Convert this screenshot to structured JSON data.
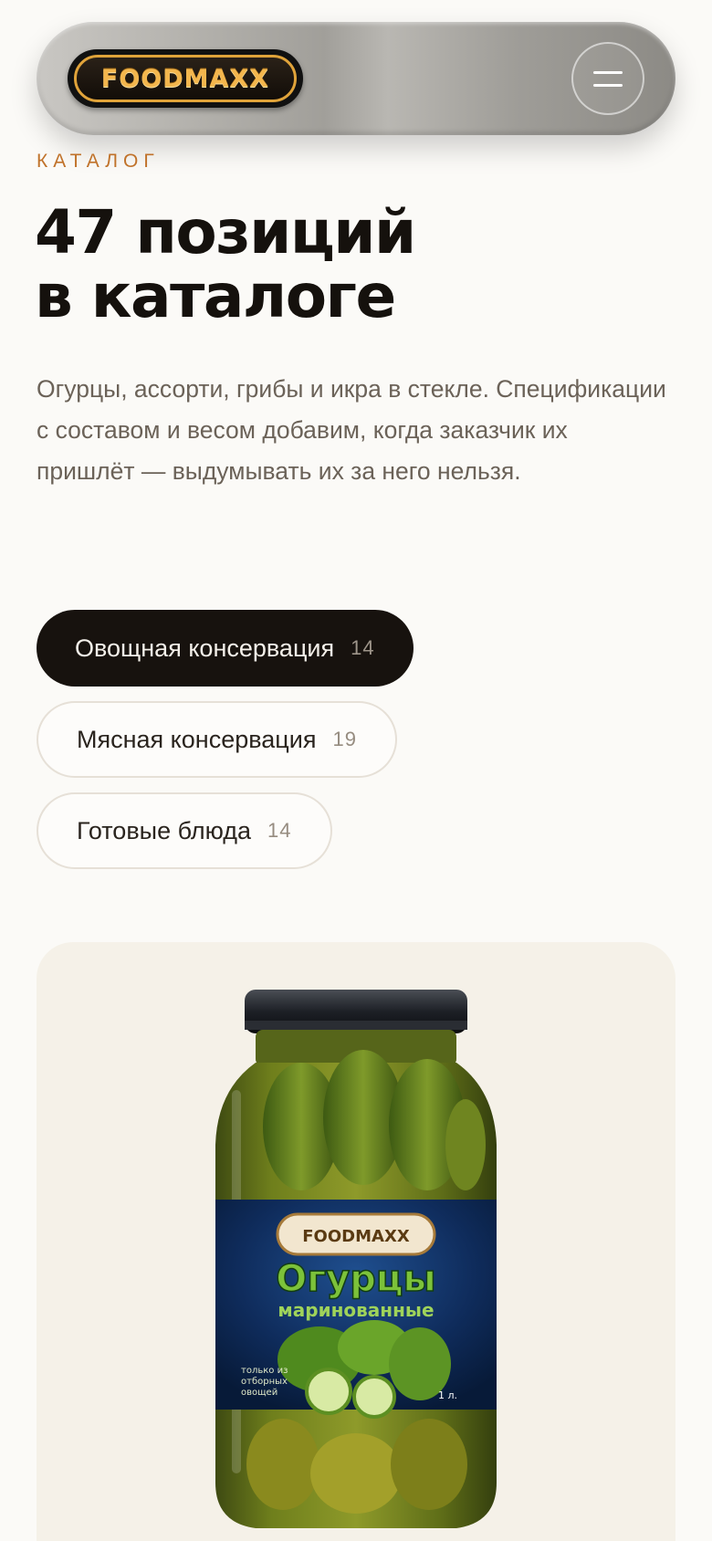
{
  "header": {
    "logo_text": "FOODMAXX",
    "menu_icon": "hamburger-menu-icon"
  },
  "hero": {
    "eyebrow": "КАТАЛОГ",
    "title_line1": "47 позиций",
    "title_line2": "в каталоге",
    "description": "Огурцы, ассорти, грибы и икра в стекле. Спецификации с составом и весом добавим, когда заказчик их пришлёт — выдумывать их за него нельзя."
  },
  "categories": [
    {
      "label": "Овощная консервация",
      "count": "14",
      "active": true
    },
    {
      "label": "Мясная консервация",
      "count": "19",
      "active": false
    },
    {
      "label": "Готовые блюда",
      "count": "14",
      "active": false
    }
  ],
  "product": {
    "label_brand": "FOODMAXX",
    "label_title": "Огурцы",
    "label_subtitle": "маринованные",
    "label_note_1": "только из",
    "label_note_2": "отборных",
    "label_note_3": "овощей",
    "label_volume": "1 л."
  },
  "colors": {
    "accent": "#c0722a",
    "dark": "#17120e",
    "background": "#fbfaf7",
    "card": "#f5f1e8"
  }
}
